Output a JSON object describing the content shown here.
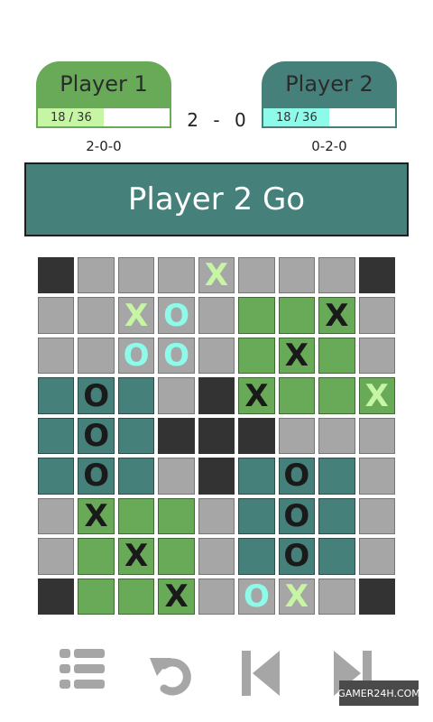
{
  "player1": {
    "name": "Player 1",
    "progress_text": "18 / 36",
    "progress": 0.5,
    "record": "2-0-0"
  },
  "player2": {
    "name": "Player 2",
    "progress_text": "18 / 36",
    "progress": 0.5,
    "record": "0-2-0"
  },
  "score": "2 - 0",
  "turn": "Player 2 Go",
  "board": [
    [
      {
        "c": "d"
      },
      {
        "c": "e"
      },
      {
        "c": "e"
      },
      {
        "c": "e"
      },
      {
        "c": "e",
        "s": "X",
        "k": "lime"
      },
      {
        "c": "e"
      },
      {
        "c": "e"
      },
      {
        "c": "e"
      },
      {
        "c": "d"
      }
    ],
    [
      {
        "c": "e"
      },
      {
        "c": "e"
      },
      {
        "c": "e",
        "s": "X",
        "k": "lime"
      },
      {
        "c": "e",
        "s": "O",
        "k": "cyan"
      },
      {
        "c": "e"
      },
      {
        "c": "g"
      },
      {
        "c": "g"
      },
      {
        "c": "g",
        "s": "X",
        "k": "dark"
      },
      {
        "c": "e"
      }
    ],
    [
      {
        "c": "e"
      },
      {
        "c": "e"
      },
      {
        "c": "e",
        "s": "O",
        "k": "cyan"
      },
      {
        "c": "e",
        "s": "O",
        "k": "cyan"
      },
      {
        "c": "e"
      },
      {
        "c": "g"
      },
      {
        "c": "g",
        "s": "X",
        "k": "dark"
      },
      {
        "c": "g"
      },
      {
        "c": "e"
      }
    ],
    [
      {
        "c": "t"
      },
      {
        "c": "t",
        "s": "O",
        "k": "dark"
      },
      {
        "c": "t"
      },
      {
        "c": "e"
      },
      {
        "c": "d"
      },
      {
        "c": "g",
        "s": "X",
        "k": "dark"
      },
      {
        "c": "g"
      },
      {
        "c": "g"
      },
      {
        "c": "g",
        "s": "X",
        "k": "lime"
      }
    ],
    [
      {
        "c": "t"
      },
      {
        "c": "t",
        "s": "O",
        "k": "dark"
      },
      {
        "c": "t"
      },
      {
        "c": "d"
      },
      {
        "c": "d"
      },
      {
        "c": "d"
      },
      {
        "c": "e"
      },
      {
        "c": "e"
      },
      {
        "c": "e"
      }
    ],
    [
      {
        "c": "t"
      },
      {
        "c": "t",
        "s": "O",
        "k": "dark"
      },
      {
        "c": "t"
      },
      {
        "c": "e"
      },
      {
        "c": "d"
      },
      {
        "c": "t"
      },
      {
        "c": "t",
        "s": "O",
        "k": "dark"
      },
      {
        "c": "t"
      },
      {
        "c": "e"
      }
    ],
    [
      {
        "c": "e"
      },
      {
        "c": "g",
        "s": "X",
        "k": "dark"
      },
      {
        "c": "g"
      },
      {
        "c": "g"
      },
      {
        "c": "e"
      },
      {
        "c": "t"
      },
      {
        "c": "t",
        "s": "O",
        "k": "dark"
      },
      {
        "c": "t"
      },
      {
        "c": "e"
      }
    ],
    [
      {
        "c": "e"
      },
      {
        "c": "g"
      },
      {
        "c": "g",
        "s": "X",
        "k": "dark"
      },
      {
        "c": "g"
      },
      {
        "c": "e"
      },
      {
        "c": "t"
      },
      {
        "c": "t",
        "s": "O",
        "k": "dark"
      },
      {
        "c": "t"
      },
      {
        "c": "e"
      }
    ],
    [
      {
        "c": "d"
      },
      {
        "c": "g"
      },
      {
        "c": "g"
      },
      {
        "c": "g",
        "s": "X",
        "k": "dark"
      },
      {
        "c": "e"
      },
      {
        "c": "e",
        "s": "O",
        "k": "cyan"
      },
      {
        "c": "e",
        "s": "X",
        "k": "lime"
      },
      {
        "c": "e"
      },
      {
        "c": "d"
      }
    ]
  ],
  "controls": {
    "menu": "list-menu-icon",
    "undo": "undo-icon",
    "first": "skip-to-start-icon",
    "next": "skip-to-end-icon"
  },
  "watermark": "GAMER24H.COM",
  "colors": {
    "player1": "#68aa58",
    "player2": "#46807a",
    "empty": "#a6a6a6",
    "blocked": "#333333",
    "icon": "#a6a6a6"
  }
}
